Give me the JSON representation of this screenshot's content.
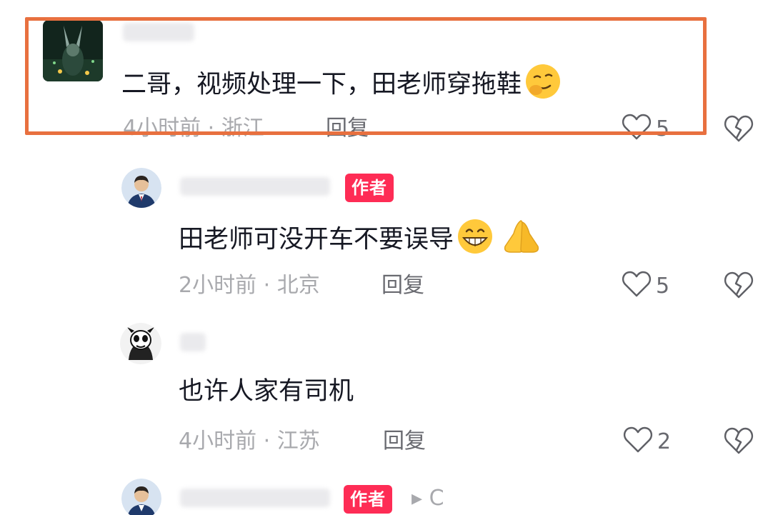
{
  "comments": [
    {
      "text": "二哥，视频处理一下，田老师穿拖鞋",
      "time": "4小时前",
      "location": "浙江",
      "reply_label": "回复",
      "likes": "5",
      "highlighted": true
    },
    {
      "badge": "作者",
      "text": "田老师可没开车不要误导",
      "time": "2小时前",
      "location": "北京",
      "reply_label": "回复",
      "likes": "5"
    },
    {
      "text": "也许人家有司机",
      "time": "4小时前",
      "location": "江苏",
      "reply_label": "回复",
      "likes": "2"
    },
    {
      "badge": "作者",
      "more_label": "▸ C"
    }
  ],
  "meta_separator": " · ",
  "icons": {
    "like": "heart-outline-icon",
    "dislike": "broken-heart-icon",
    "emoji_1": "smirk-emoji",
    "emoji_2": "grin-emoji",
    "emoji_3": "folded-hands-emoji"
  },
  "colors": {
    "badge": "#fe2c55",
    "highlight_border": "#e8703f",
    "text_primary": "#161823",
    "text_secondary": "#a8a9ad"
  }
}
